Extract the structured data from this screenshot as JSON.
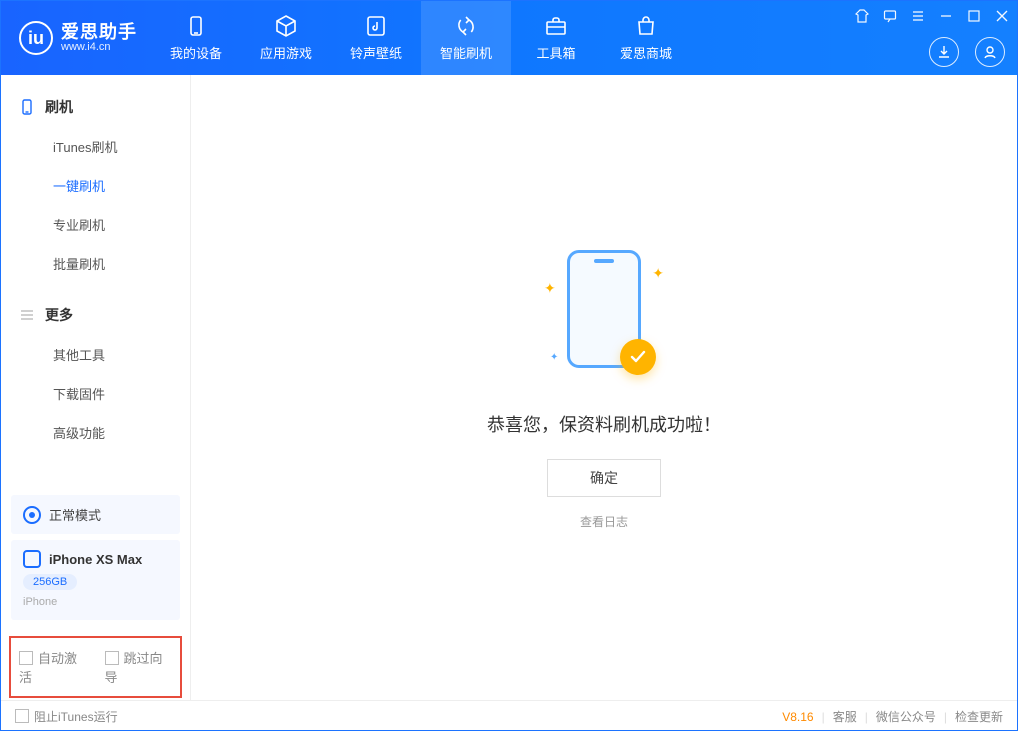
{
  "brand": {
    "title": "爱思助手",
    "subtitle": "www.i4.cn",
    "logo_letter": "iu"
  },
  "nav": {
    "items": [
      {
        "label": "我的设备",
        "icon": "device-icon"
      },
      {
        "label": "应用游戏",
        "icon": "cube-icon"
      },
      {
        "label": "铃声壁纸",
        "icon": "music-icon"
      },
      {
        "label": "智能刷机",
        "icon": "refresh-icon",
        "active": true
      },
      {
        "label": "工具箱",
        "icon": "toolbox-icon"
      },
      {
        "label": "爱思商城",
        "icon": "bag-icon"
      }
    ]
  },
  "sidebar": {
    "groups": [
      {
        "title": "刷机",
        "icon": "flash-group-icon",
        "items": [
          {
            "label": "iTunes刷机"
          },
          {
            "label": "一键刷机",
            "active": true
          },
          {
            "label": "专业刷机"
          },
          {
            "label": "批量刷机"
          }
        ]
      },
      {
        "title": "更多",
        "icon": "more-group-icon",
        "items": [
          {
            "label": "其他工具"
          },
          {
            "label": "下载固件"
          },
          {
            "label": "高级功能"
          }
        ]
      }
    ],
    "status": {
      "label": "正常模式"
    },
    "device": {
      "name": "iPhone XS Max",
      "capacity": "256GB",
      "type": "iPhone"
    },
    "options": {
      "auto_activate": "自动激活",
      "skip_wizard": "跳过向导"
    }
  },
  "main": {
    "success_title": "恭喜您，保资料刷机成功啦！",
    "ok_label": "确定",
    "log_label": "查看日志"
  },
  "footer": {
    "block_itunes": "阻止iTunes运行",
    "version": "V8.16",
    "links": {
      "support": "客服",
      "wechat": "微信公众号",
      "update": "检查更新"
    }
  }
}
